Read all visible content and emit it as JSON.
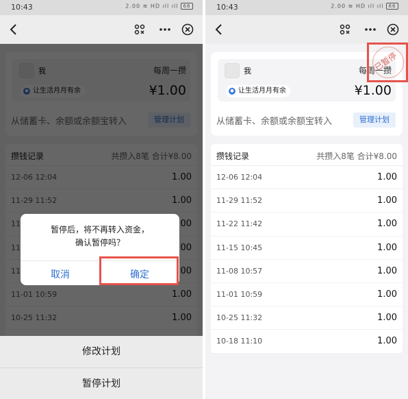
{
  "status_bar": {
    "time": "10:43",
    "icons": "2.00 ≋ HD ıll ıll",
    "battery": "66"
  },
  "plan": {
    "user_name": "我",
    "frequency": "每周一攒",
    "tag": "让生活月月有余",
    "amount": "¥1.00",
    "source": "从储蓄卡、余额或余额宝转入",
    "manage_label": "管理计划",
    "paused_stamp": "已暂停"
  },
  "records": {
    "title": "攒钱记录",
    "summary": "共攒入8笔 合计¥8.00",
    "rows": [
      {
        "date": "12-06 12:04",
        "amount": "1.00"
      },
      {
        "date": "11-29 11:52",
        "amount": "1.00"
      },
      {
        "date": "11-22 11:42",
        "amount": "1.00"
      },
      {
        "date": "11-15 10:45",
        "amount": "1.00"
      },
      {
        "date": "11-08 10:57",
        "amount": "1.00"
      },
      {
        "date": "11-01 10:59",
        "amount": "1.00"
      },
      {
        "date": "10-25 11:32",
        "amount": "1.00"
      },
      {
        "date": "10-18 11:10",
        "amount": "1.00"
      }
    ]
  },
  "dialog": {
    "message_line1": "暂停后，将不再转入资金，",
    "message_line2": "确认暂停吗？",
    "cancel_label": "取消",
    "confirm_label": "确定"
  },
  "action_sheet": {
    "items": [
      {
        "label": "修改计划"
      },
      {
        "label": "暂停计划"
      }
    ]
  },
  "colors": {
    "accent": "#2f6fd0",
    "highlight": "#e5534b",
    "background": "#f3f3f5"
  },
  "icons": [
    "back-icon",
    "scan-icon",
    "more-icon",
    "close-icon",
    "cat-logo-icon"
  ]
}
